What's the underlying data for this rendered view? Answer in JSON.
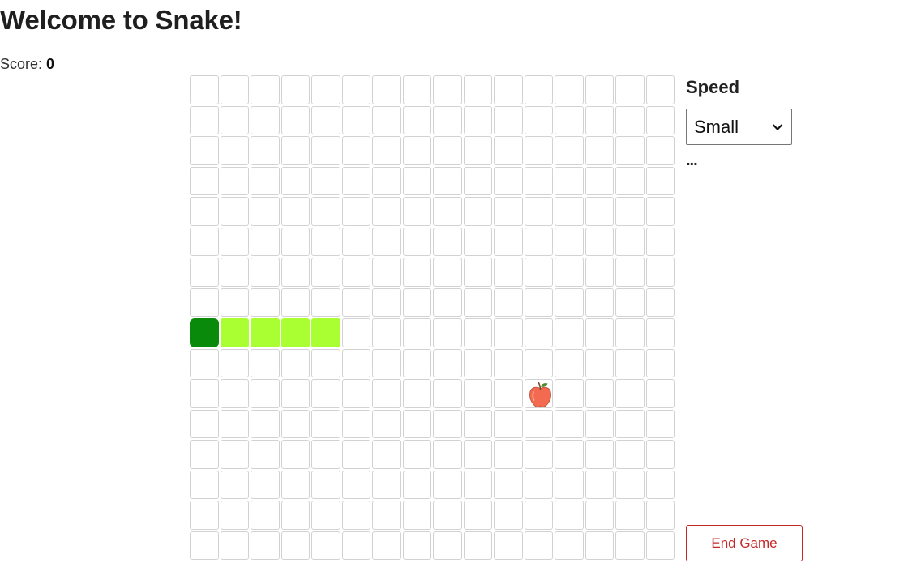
{
  "header": {
    "title": "Welcome to Snake!"
  },
  "score": {
    "label": "Score:",
    "value": "0"
  },
  "board": {
    "rows": 16,
    "cols": 16,
    "snake": [
      {
        "row": 8,
        "col": 0,
        "part": "head"
      },
      {
        "row": 8,
        "col": 1,
        "part": "body"
      },
      {
        "row": 8,
        "col": 2,
        "part": "body"
      },
      {
        "row": 8,
        "col": 3,
        "part": "body"
      },
      {
        "row": 8,
        "col": 4,
        "part": "body"
      }
    ],
    "apple": {
      "row": 10,
      "col": 11,
      "icon": "apple-icon"
    },
    "colors": {
      "head": "#0a8a0a",
      "body": "#aaff33",
      "apple": "#f26b50",
      "grid_line": "#d2d2d2"
    }
  },
  "sidebar": {
    "speed_label": "Speed",
    "speed_select": {
      "selected": "Small",
      "icon": "chevron-down-icon"
    },
    "ellipsis": "..."
  },
  "actions": {
    "end_game_label": "End Game",
    "end_game_color": "#c62828"
  }
}
